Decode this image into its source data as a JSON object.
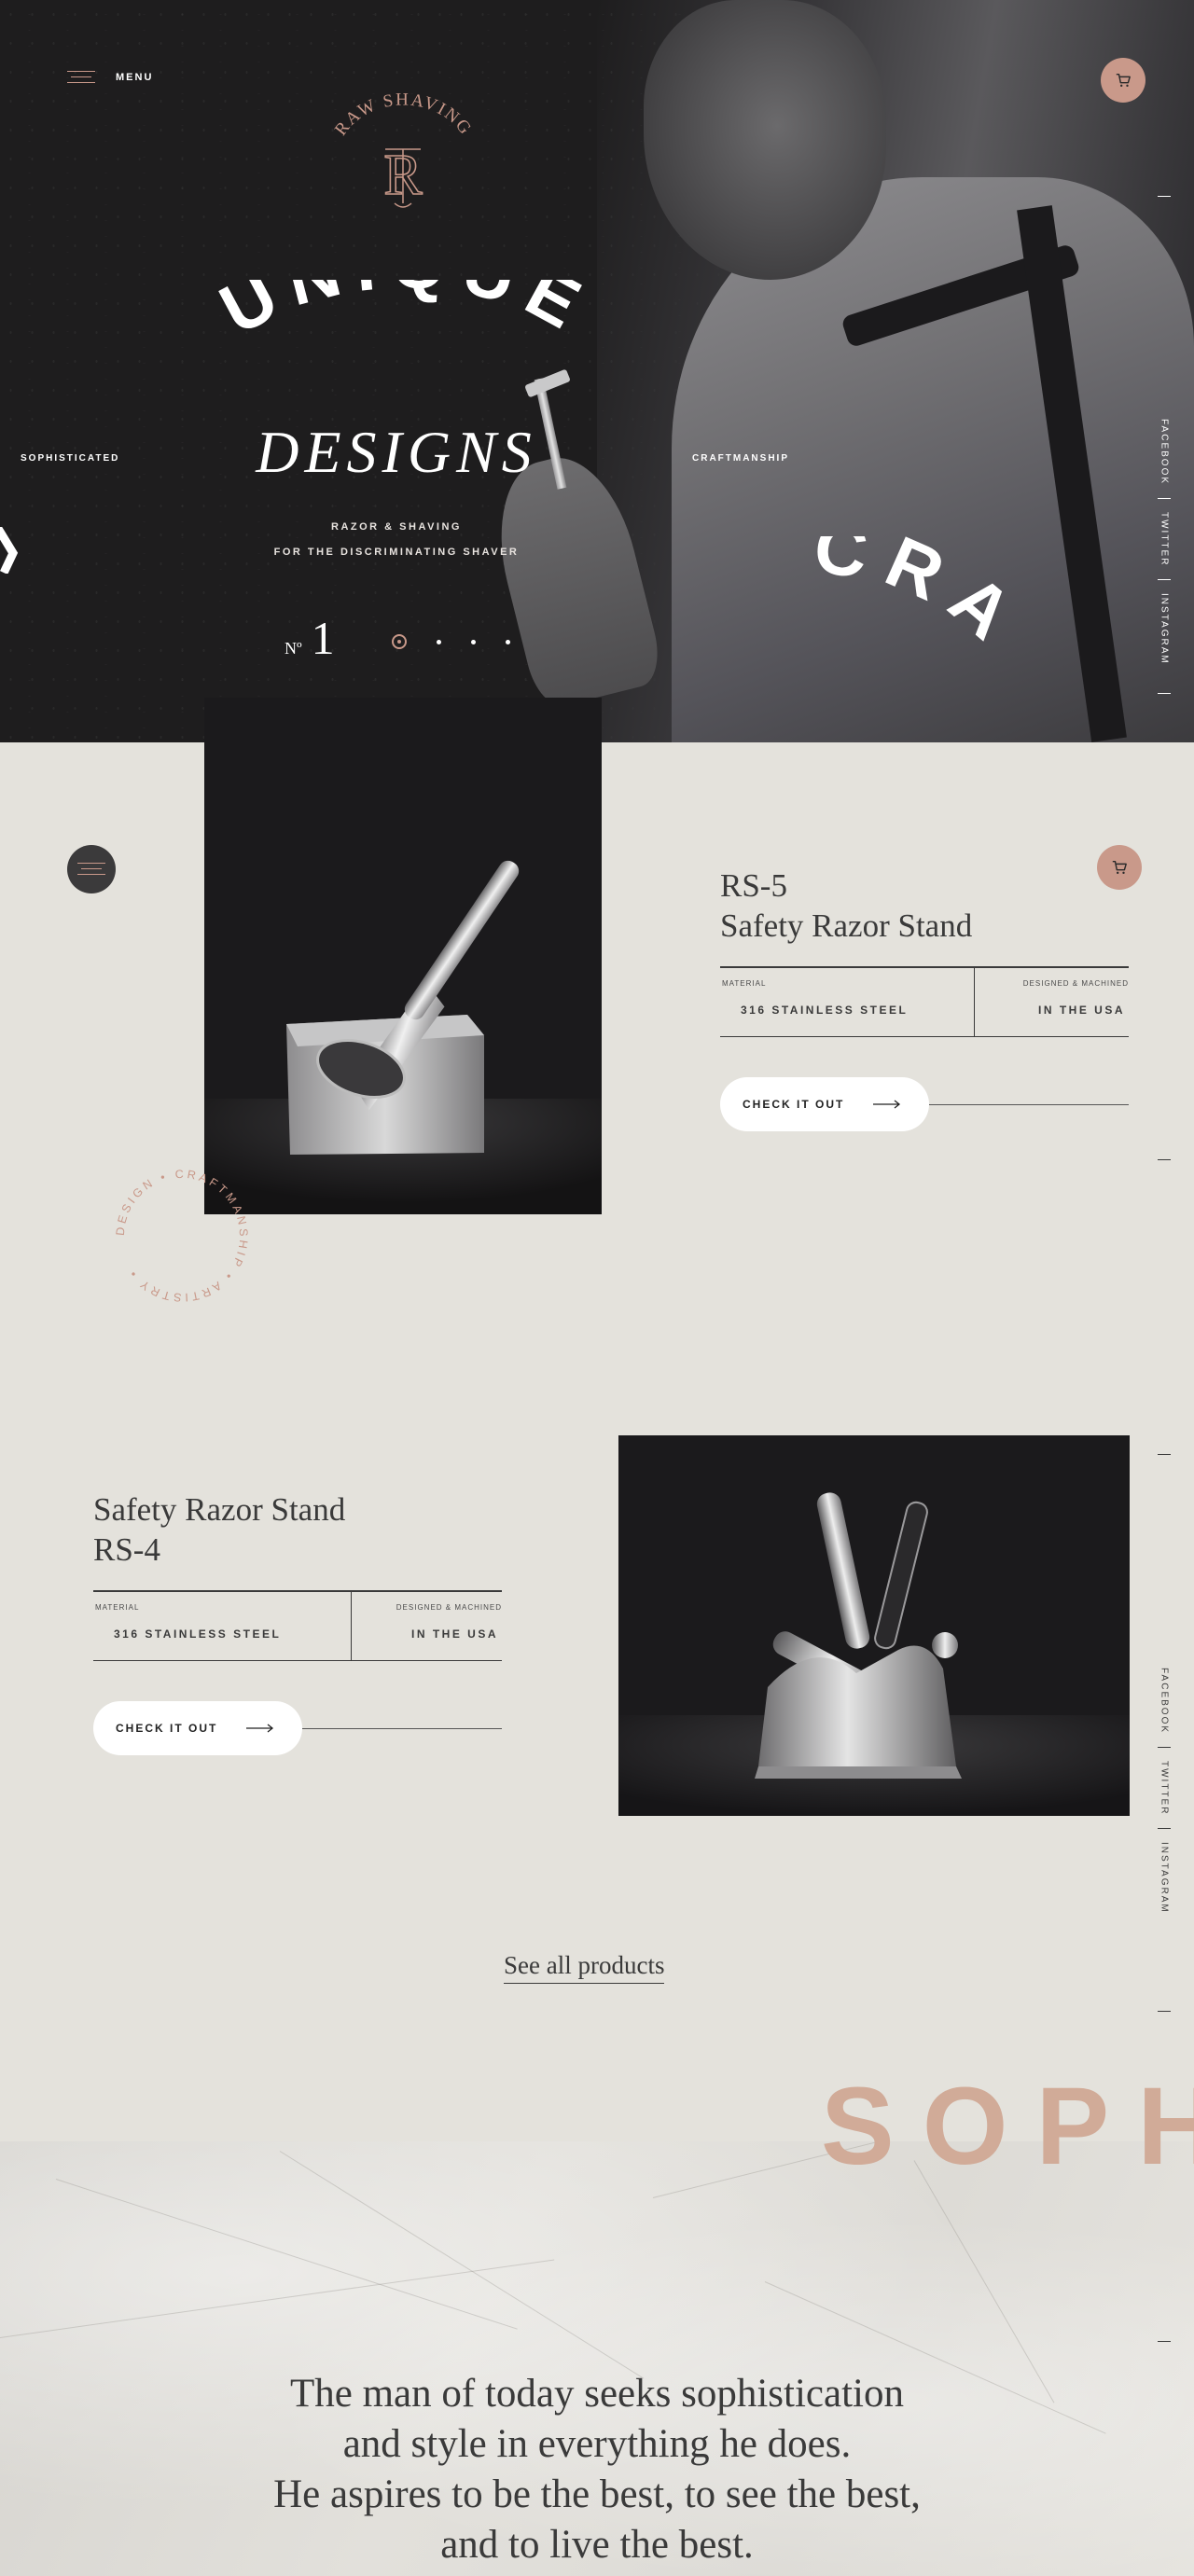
{
  "header": {
    "menu_label": "MENU",
    "brand": "RAW SHAVING",
    "brand_monogram": "R"
  },
  "hero": {
    "title": "UNIQUE",
    "script": "DESIGNS",
    "subtitle_line1": "RAZOR & SHAVING",
    "subtitle_line2": "FOR THE DISCRIMINATING SHAVER",
    "left_word": "SOPHISTICATED",
    "right_word": "CRAFTMANSHIP",
    "big_word": "CRA",
    "slide_prefix": "Nº",
    "slide_number": "1",
    "slide_count": 4,
    "active_slide": 1
  },
  "social": {
    "facebook": "FACEBOOK",
    "twitter": "TWITTER",
    "instagram": "INSTAGRAM"
  },
  "products": [
    {
      "title_line1": "RS-5",
      "title_line2": "Safety Razor Stand",
      "material_label": "MATERIAL",
      "material": "316 STAINLESS STEEL",
      "origin_label": "DESIGNED & MACHINED",
      "origin": "IN THE USA",
      "cta": "CHECK IT OUT"
    },
    {
      "title_line1": "Safety Razor Stand",
      "title_line2": "RS-4",
      "material_label": "MATERIAL",
      "material": "316 STAINLESS STEEL",
      "origin_label": "DESIGNED & MACHINED",
      "origin": "IN THE USA",
      "cta": "CHECK IT OUT"
    }
  ],
  "badge": {
    "text": "DESIGN • CRAFTMANSHIP • ARTISTRY • "
  },
  "see_all": "See all products",
  "big_word": "SOPH",
  "quote": {
    "line1": "The man of today seeks sophistication",
    "line2": "and style in everything he does.",
    "line3": "He aspires to be the best, to see the best,",
    "line4": "and to live the best."
  },
  "colors": {
    "accent": "#c9998a",
    "dark": "#1e1d1e",
    "bg": "#e4e2dc",
    "soph": "#d1ab98"
  },
  "icons": {
    "menu": "hamburger-icon",
    "cart": "cart-icon",
    "arrow": "arrow-right-icon"
  }
}
